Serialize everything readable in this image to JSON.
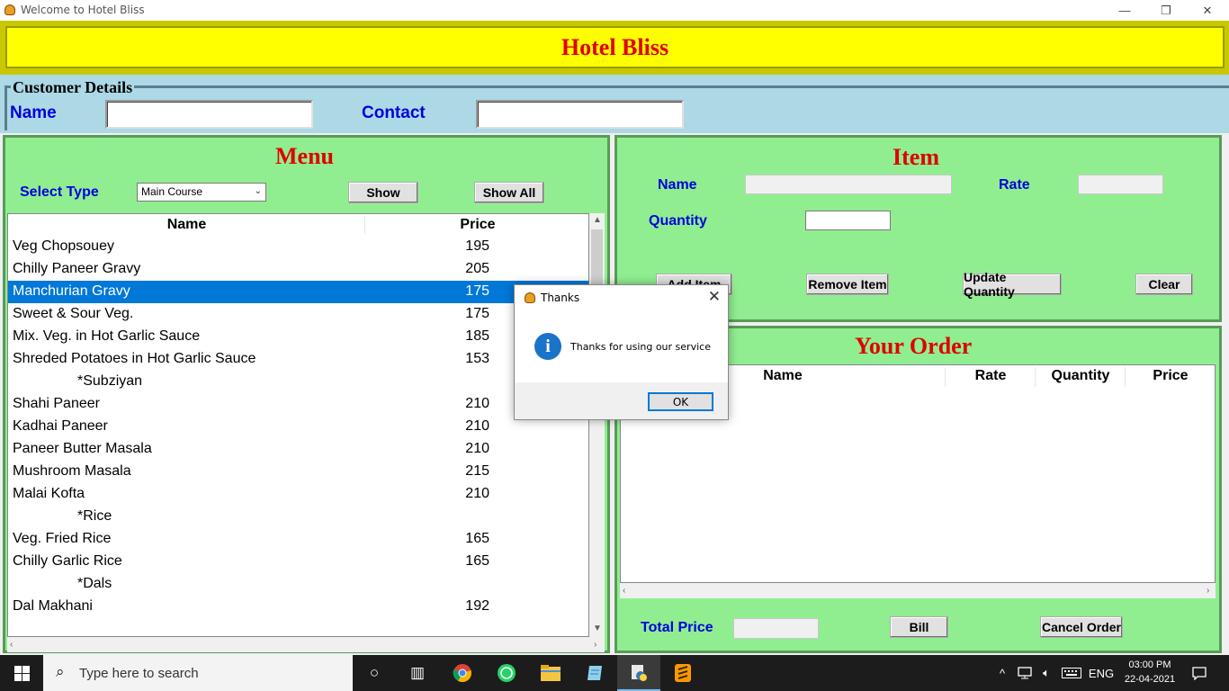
{
  "window": {
    "title": "Welcome to Hotel Bliss",
    "controls": {
      "minimize": "—",
      "maximize": "❐",
      "close": "✕"
    }
  },
  "header": {
    "title": "Hotel Bliss"
  },
  "customer": {
    "legend": "Customer Details",
    "name_label": "Name",
    "name_value": "",
    "contact_label": "Contact",
    "contact_value": ""
  },
  "menu": {
    "title": "Menu",
    "select_type_label": "Select Type",
    "select_type_value": "Main Course",
    "show_button": "Show",
    "show_all_button": "Show All",
    "columns": [
      "Name",
      "Price"
    ],
    "rows": [
      {
        "name": "Veg Chopsouey",
        "price": "195"
      },
      {
        "name": "Chilly Paneer Gravy",
        "price": "205"
      },
      {
        "name": "Manchurian Gravy",
        "price": "175",
        "selected": true
      },
      {
        "name": "Sweet & Sour Veg.",
        "price": "175"
      },
      {
        "name": "Mix. Veg. in Hot Garlic Sauce",
        "price": "185"
      },
      {
        "name": "Shreded Potatoes in Hot Garlic Sauce",
        "price": "153"
      },
      {
        "name": "*Subziyan",
        "price": "",
        "category": true
      },
      {
        "name": "Shahi Paneer",
        "price": "210"
      },
      {
        "name": "Kadhai Paneer",
        "price": "210"
      },
      {
        "name": "Paneer Butter Masala",
        "price": "210"
      },
      {
        "name": "Mushroom Masala",
        "price": "215"
      },
      {
        "name": "Malai Kofta",
        "price": "210"
      },
      {
        "name": "*Rice",
        "price": "",
        "category": true
      },
      {
        "name": "Veg. Fried Rice",
        "price": "165"
      },
      {
        "name": "Chilly Garlic Rice",
        "price": "165"
      },
      {
        "name": "*Dals",
        "price": "",
        "category": true
      },
      {
        "name": "Dal Makhani",
        "price": "192"
      }
    ]
  },
  "item": {
    "title": "Item",
    "name_label": "Name",
    "rate_label": "Rate",
    "quantity_label": "Quantity",
    "add_button": "Add Item",
    "remove_button": "Remove Item",
    "update_button": "Update Quantity",
    "clear_button": "Clear"
  },
  "order": {
    "title": "Your Order",
    "columns": [
      "Name",
      "Rate",
      "Quantity",
      "Price"
    ],
    "total_label": "Total Price",
    "bill_button": "Bill",
    "cancel_button": "Cancel Order"
  },
  "dialog": {
    "title": "Thanks",
    "message": "Thanks for using our service",
    "ok_button": "OK",
    "icon": "info-icon"
  },
  "taskbar": {
    "search_placeholder": "Type here to search",
    "language": "ENG",
    "time": "03:00 PM",
    "date": "22-04-2021"
  },
  "colors": {
    "header_bg": "#ffff00",
    "title_red": "#e00000",
    "label_blue": "#0000dd",
    "panel_green": "#90ee90",
    "customer_bg": "#add8e6",
    "selection": "#0078d7"
  }
}
